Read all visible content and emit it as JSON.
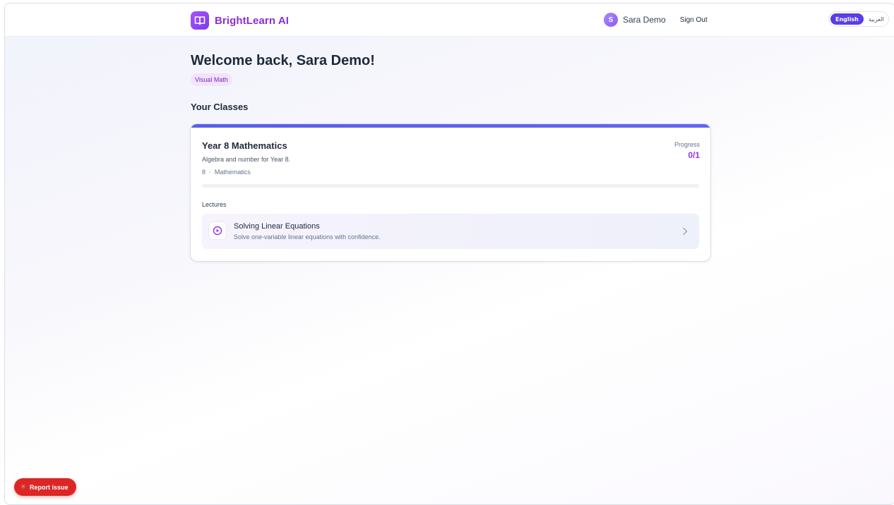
{
  "header": {
    "brand_name": "BrightLearn AI",
    "brand_icon": "book-icon",
    "user_initial": "S",
    "user_name": "Sara Demo",
    "sign_out_label": "Sign Out"
  },
  "language": {
    "options": [
      "English",
      "العربية"
    ],
    "selected": "English"
  },
  "main": {
    "welcome": "Welcome back, Sara Demo!",
    "tag": "Visual Math",
    "section_title": "Your Classes"
  },
  "class_card": {
    "title": "Year 8 Mathematics",
    "description": "Algebra and number for Year 8.",
    "grade": "8",
    "subject": "Mathematics",
    "progress_label": "Progress",
    "progress_value": "0/1",
    "progress_fraction": 0,
    "lectures_label": "Lectures",
    "lectures": [
      {
        "title": "Solving Linear Equations",
        "description": "Solve one-variable linear equations with confidence.",
        "icon": "play-circle-icon"
      }
    ]
  },
  "report_button": {
    "label": "Report issue"
  },
  "colors": {
    "brand": "#8b2fd8",
    "accent_purple": "#9333ea",
    "language_active": "#5b3de8",
    "card_accent": "#6366f1",
    "report_red": "#dc2626"
  }
}
